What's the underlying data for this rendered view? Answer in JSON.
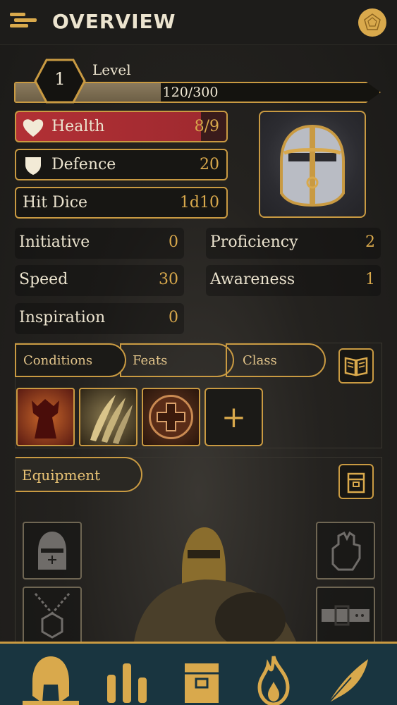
{
  "header": {
    "title": "OVERVIEW",
    "menu_icon": "menu-icon",
    "dice_icon": "d20-dice-icon"
  },
  "level": {
    "label": "Level",
    "value": "1",
    "xp_text": "120/300",
    "xp_current": 120,
    "xp_max": 300
  },
  "stats": {
    "health": {
      "label": "Health",
      "value": "8/9",
      "icon": "heart-icon"
    },
    "defence": {
      "label": "Defence",
      "value": "20",
      "icon": "shield-icon"
    },
    "hit_dice": {
      "label": "Hit Dice",
      "value": "1d10"
    }
  },
  "attributes": {
    "initiative": {
      "label": "Initiative",
      "value": "0"
    },
    "proficiency": {
      "label": "Proficiency",
      "value": "2"
    },
    "speed": {
      "label": "Speed",
      "value": "30"
    },
    "awareness": {
      "label": "Awareness",
      "value": "1"
    },
    "inspiration": {
      "label": "Inspiration",
      "value": "0"
    }
  },
  "tabs": [
    {
      "label": "Conditions"
    },
    {
      "label": "Feats"
    },
    {
      "label": "Class"
    }
  ],
  "active_tab": "Feats",
  "feats_add_label": "+",
  "equipment": {
    "label": "Equipment"
  },
  "colors": {
    "accent": "#d9a94c",
    "health": "#b23035",
    "nav_bg": "#193540"
  },
  "nav": [
    {
      "icon": "spartan-helmet-icon",
      "active": true
    },
    {
      "icon": "stats-bars-icon"
    },
    {
      "icon": "backpack-icon"
    },
    {
      "icon": "flame-icon"
    },
    {
      "icon": "quill-feather-icon"
    }
  ]
}
